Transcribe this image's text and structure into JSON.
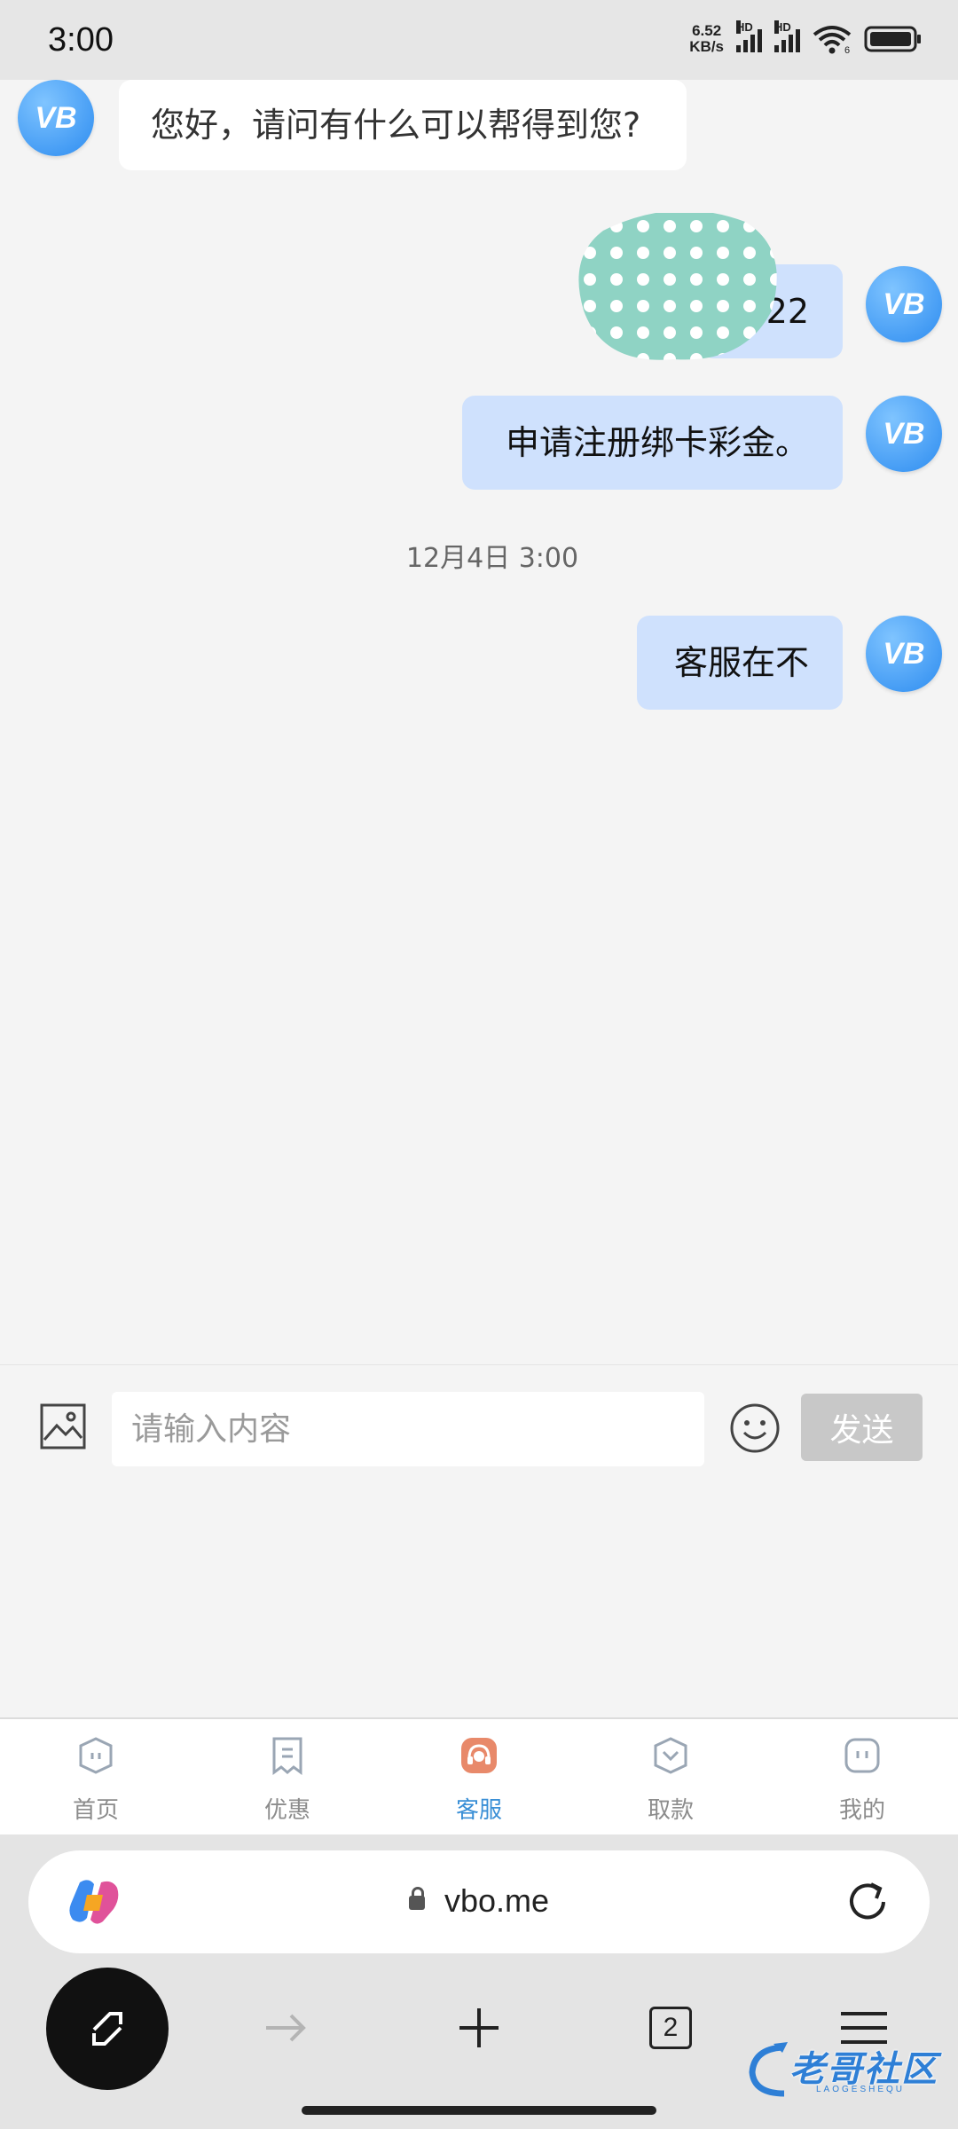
{
  "status_bar": {
    "time": "3:00",
    "net_speed_value": "6.52",
    "net_speed_unit": "KB/s",
    "signal_label": "HD",
    "wifi_label": "6"
  },
  "chat": {
    "messages": [
      {
        "side": "left",
        "text": "您好，请问有什么可以帮得到您?"
      },
      {
        "side": "right",
        "text": "22"
      },
      {
        "side": "right",
        "text": "申请注册绑卡彩金。"
      },
      {
        "side": "right",
        "text": "客服在不"
      }
    ],
    "timestamp": "12月4日 3:00",
    "avatar_text": "VB"
  },
  "input": {
    "placeholder": "请输入内容",
    "send_label": "发送"
  },
  "tabs": [
    {
      "label": "首页",
      "icon": "home-icon",
      "active": false
    },
    {
      "label": "优惠",
      "icon": "promo-icon",
      "active": false
    },
    {
      "label": "客服",
      "icon": "customer-service-icon",
      "active": true
    },
    {
      "label": "取款",
      "icon": "withdraw-icon",
      "active": false
    },
    {
      "label": "我的",
      "icon": "profile-icon",
      "active": false
    }
  ],
  "browser": {
    "url": "vbo.me",
    "tab_count": "2"
  },
  "watermark": {
    "text": "老哥社区",
    "subtext": "LAOGESHEQU"
  },
  "colors": {
    "accent": "#3a8fd6",
    "bubble_right": "#cfe1fd",
    "avatar": "#2d8cf0",
    "sticker": "#8fd3c4"
  }
}
